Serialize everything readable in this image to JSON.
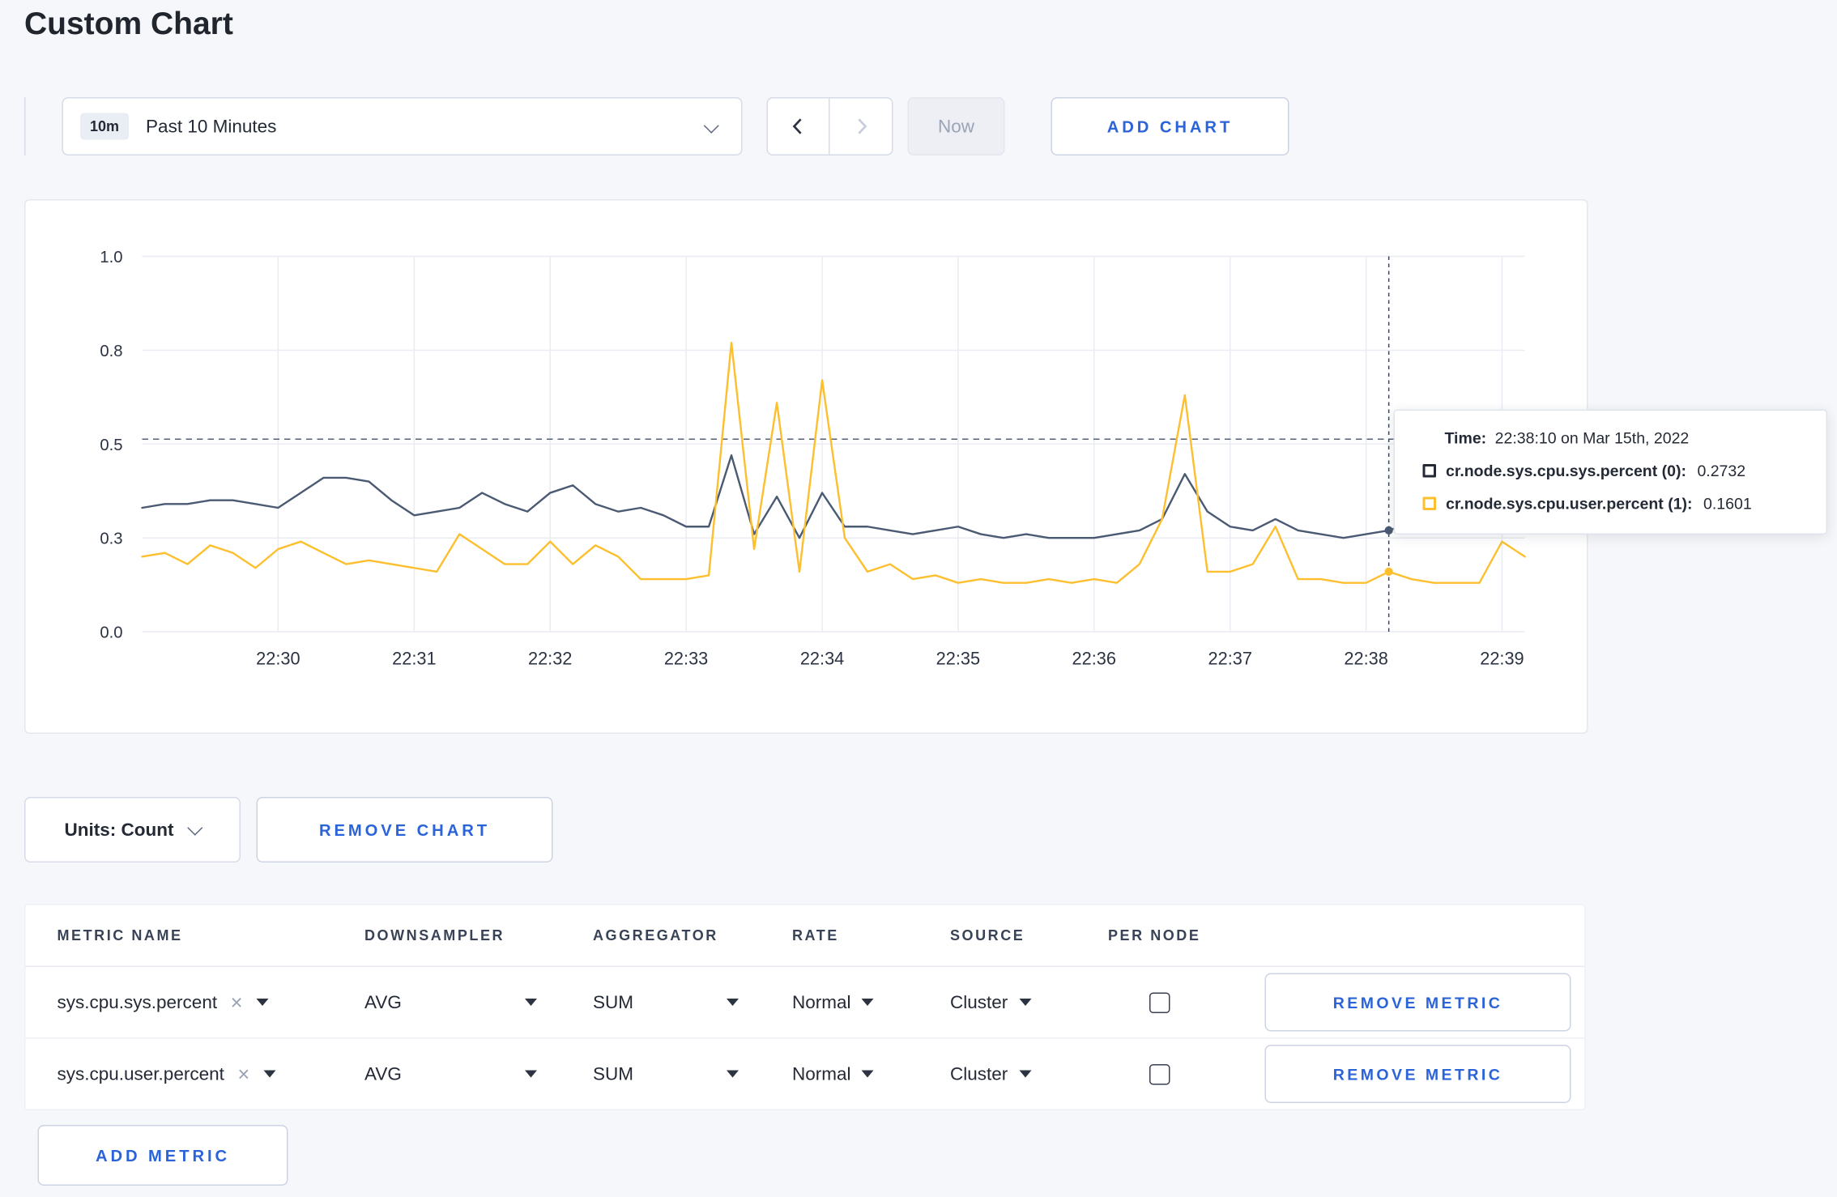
{
  "colors": {
    "accent": "#2b63d9"
  },
  "page": {
    "title": "Custom Chart"
  },
  "toolbar": {
    "time_range": {
      "badge": "10m",
      "label": "Past 10 Minutes"
    },
    "now_label": "Now",
    "add_chart_label": "ADD CHART"
  },
  "chart": {
    "tooltip": {
      "time_label": "Time:",
      "time_value": "22:38:10 on Mar 15th, 2022",
      "rows": [
        {
          "label": "cr.node.sys.cpu.sys.percent (0):",
          "value": "0.2732",
          "color": "#242a35"
        },
        {
          "label": "cr.node.sys.cpu.user.percent (1):",
          "value": "0.1601",
          "color": "#fdbf2e"
        }
      ]
    }
  },
  "chart_data": {
    "type": "line",
    "title": "",
    "xlabel": "",
    "ylabel": "",
    "x_ticks": [
      "22:30",
      "22:31",
      "22:32",
      "22:33",
      "22:34",
      "22:35",
      "22:36",
      "22:37",
      "22:38",
      "22:39"
    ],
    "y_tick_labels": [
      "1.0",
      "0.8",
      "0.5",
      "0.3",
      "0.0"
    ],
    "y_tick_values": [
      1.0,
      0.75,
      0.5,
      0.25,
      0.0
    ],
    "ylim": [
      0,
      1
    ],
    "grid": true,
    "points_per_minute": 6,
    "first_tick_index": 6,
    "crosshair": {
      "x_index": 55,
      "hline_value": 0.513,
      "time": "22:38:10"
    },
    "series": [
      {
        "name": "cr.node.sys.cpu.sys.percent",
        "color": "#4b5a73",
        "values": [
          0.33,
          0.34,
          0.34,
          0.35,
          0.35,
          0.34,
          0.33,
          0.37,
          0.41,
          0.41,
          0.4,
          0.35,
          0.31,
          0.32,
          0.33,
          0.37,
          0.34,
          0.32,
          0.37,
          0.39,
          0.34,
          0.32,
          0.33,
          0.31,
          0.28,
          0.28,
          0.47,
          0.26,
          0.36,
          0.25,
          0.37,
          0.28,
          0.28,
          0.27,
          0.26,
          0.27,
          0.28,
          0.26,
          0.25,
          0.26,
          0.25,
          0.25,
          0.25,
          0.26,
          0.27,
          0.3,
          0.42,
          0.32,
          0.28,
          0.27,
          0.3,
          0.27,
          0.26,
          0.25,
          0.26,
          0.27,
          0.29,
          0.27,
          0.27,
          0.28,
          0.27,
          0.27
        ]
      },
      {
        "name": "cr.node.sys.cpu.user.percent",
        "color": "#fdbf2e",
        "values": [
          0.2,
          0.21,
          0.18,
          0.23,
          0.21,
          0.17,
          0.22,
          0.24,
          0.21,
          0.18,
          0.19,
          0.18,
          0.17,
          0.16,
          0.26,
          0.22,
          0.18,
          0.18,
          0.24,
          0.18,
          0.23,
          0.2,
          0.14,
          0.14,
          0.14,
          0.15,
          0.77,
          0.22,
          0.61,
          0.16,
          0.67,
          0.25,
          0.16,
          0.18,
          0.14,
          0.15,
          0.13,
          0.14,
          0.13,
          0.13,
          0.14,
          0.13,
          0.14,
          0.13,
          0.18,
          0.3,
          0.63,
          0.16,
          0.16,
          0.18,
          0.28,
          0.14,
          0.14,
          0.13,
          0.13,
          0.16,
          0.14,
          0.13,
          0.13,
          0.13,
          0.24,
          0.2
        ]
      }
    ]
  },
  "units_row": {
    "units_label": "Units: Count",
    "remove_chart_label": "REMOVE CHART"
  },
  "metrics_table": {
    "headers": [
      "METRIC NAME",
      "DOWNSAMPLER",
      "AGGREGATOR",
      "RATE",
      "SOURCE",
      "PER NODE"
    ],
    "rows": [
      {
        "metric": "sys.cpu.sys.percent",
        "clear_icon": "×",
        "downsampler": "AVG",
        "aggregator": "SUM",
        "rate": "Normal",
        "source": "Cluster",
        "per_node_checked": false,
        "remove_label": "REMOVE METRIC"
      },
      {
        "metric": "sys.cpu.user.percent",
        "clear_icon": "×",
        "downsampler": "AVG",
        "aggregator": "SUM",
        "rate": "Normal",
        "source": "Cluster",
        "per_node_checked": false,
        "remove_label": "REMOVE METRIC"
      }
    ],
    "add_metric_label": "ADD METRIC"
  }
}
